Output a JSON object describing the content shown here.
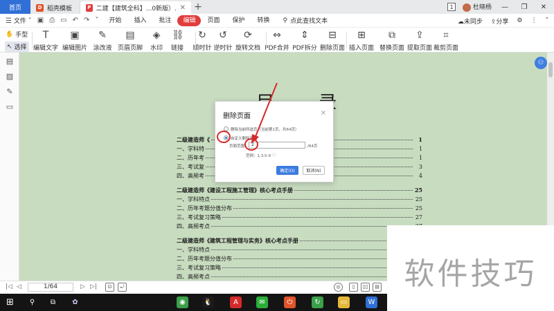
{
  "titlebar": {
    "home_tab": "首页",
    "tabs": [
      {
        "label": "稻壳模板",
        "logo_letter": "D",
        "logo_color": "#e0542a"
      },
      {
        "label": "二建【建筑全科】...0新版）.pdf",
        "logo_letter": "P",
        "logo_color": "#e23c3c"
      }
    ],
    "new_tab": "+",
    "badge": "1",
    "user": "杜晓杨",
    "win_minimize": "—",
    "win_maximize": "❐",
    "win_close": "✕"
  },
  "menubar": {
    "file_label": "文件",
    "tabs": [
      "开始",
      "插入",
      "批注",
      "编辑",
      "页面",
      "保护",
      "转换"
    ],
    "active_tab": "编辑",
    "search_label": "点此查找文本",
    "sync_label": "未同步",
    "share_label": "分享"
  },
  "ribbon": {
    "hand_label": "手型",
    "select_label": "选择",
    "tools": [
      {
        "label": "编辑文字",
        "icon": "T"
      },
      {
        "label": "编辑图片",
        "icon": "▣"
      },
      {
        "label": "涂改液",
        "icon": "✎"
      },
      {
        "label": "页眉页脚",
        "icon": "▤"
      },
      {
        "label": "水印",
        "icon": "◈"
      },
      {
        "label": "链接",
        "icon": "⛓"
      },
      {
        "label": "顺时针",
        "icon": "↻"
      },
      {
        "label": "逆时针",
        "icon": "↺"
      },
      {
        "label": "旋转文档",
        "icon": "⟳"
      },
      {
        "label": "PDF合并",
        "icon": "⇔"
      },
      {
        "label": "PDF拆分",
        "icon": "⇕"
      },
      {
        "label": "删除页面",
        "icon": "⊟"
      },
      {
        "label": "插入页面",
        "icon": "⊞"
      },
      {
        "label": "替换页面",
        "icon": "⧉"
      },
      {
        "label": "提取页面",
        "icon": "⇪"
      },
      {
        "label": "裁剪页面",
        "icon": "⌗"
      }
    ]
  },
  "document": {
    "title": "目 录",
    "toc": [
      {
        "text": "二级建造师《",
        "page": "1",
        "section": true
      },
      {
        "text": "一、学科特",
        "page": "1",
        "section": false
      },
      {
        "text": "二、历年考",
        "page": "1",
        "section": false
      },
      {
        "text": "三、考试复",
        "page": "3",
        "section": false
      },
      {
        "text": "四、高频考",
        "page": "4",
        "section": false
      },
      {
        "text": "二级建造师《建设工程施工管理》核心考点手册",
        "page": "25",
        "section": true
      },
      {
        "text": "一、学科特点",
        "page": "25",
        "section": false
      },
      {
        "text": "二、历年考题分值分布",
        "page": "25",
        "section": false
      },
      {
        "text": "三、考试复习策略",
        "page": "27",
        "section": false
      },
      {
        "text": "四、高频考点",
        "page": "27",
        "section": false
      },
      {
        "text": "二级建造师《建筑工程管理与实务》核心考点手册",
        "page": "",
        "section": true
      },
      {
        "text": "一、学科特点",
        "page": "",
        "section": false
      },
      {
        "text": "二、历年考题分值分布",
        "page": "",
        "section": false
      },
      {
        "text": "三、考试复习策略",
        "page": "",
        "section": false
      },
      {
        "text": "四、高频考点",
        "page": "",
        "section": false
      }
    ]
  },
  "dialog": {
    "title": "删除页面",
    "close": "×",
    "option_current": "删除当前所选页（当前第1页，共64页）",
    "option_custom": "自定义删除页面",
    "range_label": "页面范围",
    "range_value": "2",
    "total_pages": "/64页",
    "example": "范例：1,3,5-9",
    "ok_label": "确定(O)",
    "cancel_label": "取消(N)"
  },
  "statusbar": {
    "page_indicator": "1/64",
    "prev_first": "|◁",
    "prev": "◁",
    "next": "▷",
    "next_last": "▷|"
  },
  "watermark": {
    "text": "软件技巧"
  },
  "taskbar": {
    "start": "⊞",
    "search": "⚲",
    "task_view": "⧉",
    "apps": [
      {
        "name": "app-green",
        "color": "#3aa04a",
        "glyph": "◉"
      },
      {
        "name": "qq",
        "color": "#1a1a1a",
        "glyph": "🐧"
      },
      {
        "name": "app-red",
        "color": "#d42a2a",
        "glyph": "A"
      },
      {
        "name": "wechat",
        "color": "#2aae3a",
        "glyph": "✉"
      },
      {
        "name": "app-power",
        "color": "#e0542a",
        "glyph": "⏻"
      },
      {
        "name": "app-refresh",
        "color": "#3aa04a",
        "glyph": "↻"
      },
      {
        "name": "file-explorer",
        "color": "#e6b83a",
        "glyph": "▭"
      },
      {
        "name": "wps",
        "color": "#2f6fd6",
        "glyph": "W"
      }
    ]
  },
  "colors": {
    "doc_background": "#c8dcc0",
    "accent": "#e23c3c",
    "highlight_blue": "#2f6fd6",
    "annotation_red": "#d42a2a"
  }
}
